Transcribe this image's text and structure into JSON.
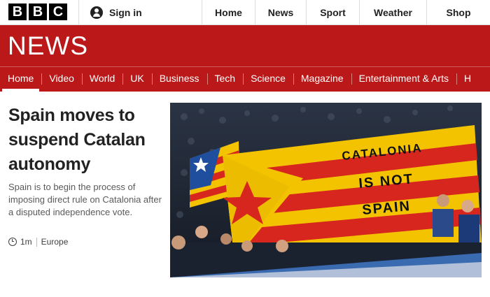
{
  "brand": {
    "letters": [
      "B",
      "B",
      "C"
    ],
    "section_title": "NEWS"
  },
  "account": {
    "signin_label": "Sign in"
  },
  "top_nav": [
    {
      "label": "Home"
    },
    {
      "label": "News"
    },
    {
      "label": "Sport"
    },
    {
      "label": "Weather"
    },
    {
      "label": "Shop"
    }
  ],
  "news_nav": [
    {
      "label": "Home",
      "active": true
    },
    {
      "label": "Video"
    },
    {
      "label": "World"
    },
    {
      "label": "UK"
    },
    {
      "label": "Business"
    },
    {
      "label": "Tech"
    },
    {
      "label": "Science"
    },
    {
      "label": "Magazine"
    },
    {
      "label": "Entertainment & Arts"
    },
    {
      "label": "H"
    }
  ],
  "story": {
    "headline": "Spain moves to suspend Catalan autonomy",
    "summary": "Spain is to begin the process of imposing direct rule on Catalonia after a disputed independence vote.",
    "time": "1m",
    "section": "Europe",
    "image_banner": [
      "CATALONIA",
      "IS NOT",
      "SPAIN"
    ]
  },
  "colors": {
    "brand_red": "#bb1919",
    "flag_yellow": "#f3c300",
    "flag_red": "#d6261e",
    "star_blue": "#1f4e9e"
  },
  "icons": {
    "account": "user-avatar-icon",
    "timestamp": "clock-icon"
  }
}
